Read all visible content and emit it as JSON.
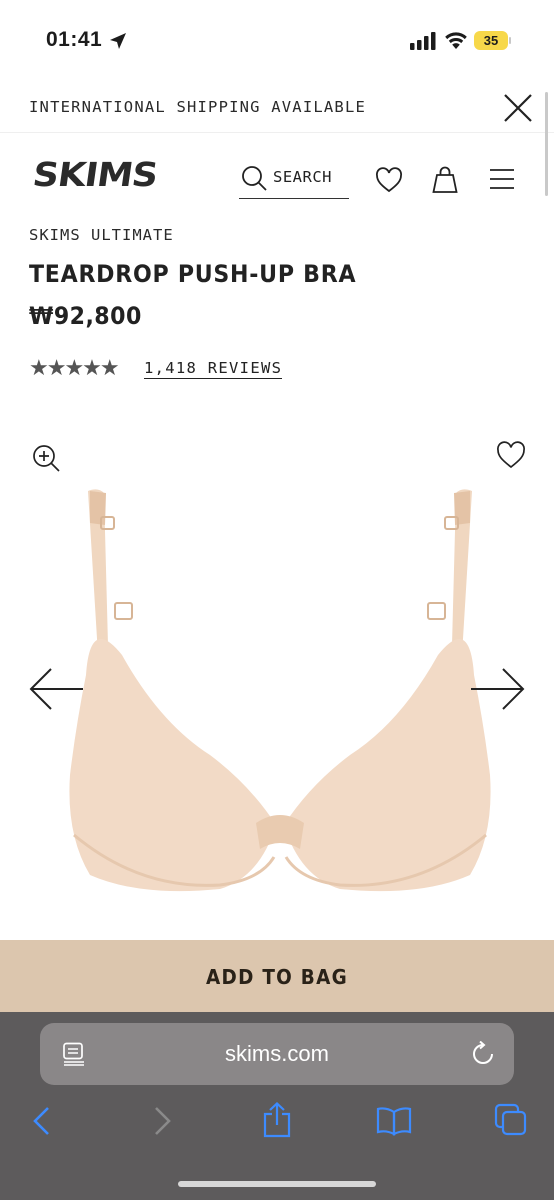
{
  "status_bar": {
    "time": "01:41",
    "battery": "35"
  },
  "promo": {
    "text": "INTERNATIONAL SHIPPING AVAILABLE"
  },
  "header": {
    "logo": "SKIMS",
    "search_label": "SEARCH"
  },
  "product": {
    "brand": "SKIMS ULTIMATE",
    "title": "TEARDROP PUSH-UP BRA",
    "price": "₩92,800",
    "rating_stars": "★★★★★",
    "rating_value": 5,
    "reviews": "1,418 REVIEWS"
  },
  "cta": {
    "add_to_bag": "ADD TO BAG"
  },
  "browser": {
    "url": "skims.com"
  },
  "colors": {
    "accent": "#dcc6ae",
    "product_nude": "#f1d8c2",
    "safari_bar": "#5d5b5c"
  }
}
